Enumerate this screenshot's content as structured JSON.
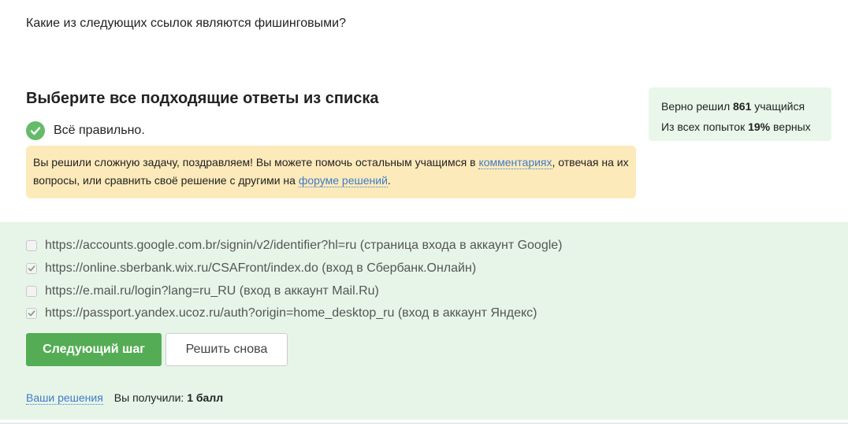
{
  "question": "Какие из следующих ссылок являются фишинговыми?",
  "instruction": "Выберите все подходящие ответы из списка",
  "result": "Всё правильно.",
  "hint": {
    "text_before": "Вы решили сложную задачу, поздравляем! Вы можете помочь остальным учащимся в ",
    "link_comments": "комментариях",
    "text_middle": ", отвечая на их вопросы, или сравнить своё решение с другими на ",
    "link_forum": "форуме решений",
    "text_after": "."
  },
  "stats": {
    "solved_prefix": "Верно решил ",
    "solved_count": "861",
    "solved_suffix": " учащийся",
    "attempts_prefix": "Из всех попыток ",
    "attempts_percent": "19%",
    "attempts_suffix": " верных"
  },
  "options": [
    {
      "label": "https://accounts.google.com.br/signin/v2/identifier?hl=ru (страница входа в аккаунт Google)",
      "checked": false
    },
    {
      "label": "https://online.sberbank.wix.ru/CSAFront/index.do (вход в Сбербанк.Онлайн)",
      "checked": true
    },
    {
      "label": "https://e.mail.ru/login?lang=ru_RU (вход в аккаунт Mail.Ru)",
      "checked": false
    },
    {
      "label": "https://passport.yandex.ucoz.ru/auth?origin=home_desktop_ru (вход в аккаунт Яндекс)",
      "checked": true
    }
  ],
  "buttons": {
    "next": "Следующий шаг",
    "retry": "Решить снова"
  },
  "footer": {
    "solutions_link": "Ваши решения",
    "score_prefix": "Вы получили: ",
    "score_value": "1 балл"
  },
  "colors": {
    "success": "#66bb6a",
    "button_green": "#54ad54",
    "hint_bg": "#fdeaba",
    "answer_bg": "#e7f5e8",
    "link": "#3e7bc9"
  }
}
